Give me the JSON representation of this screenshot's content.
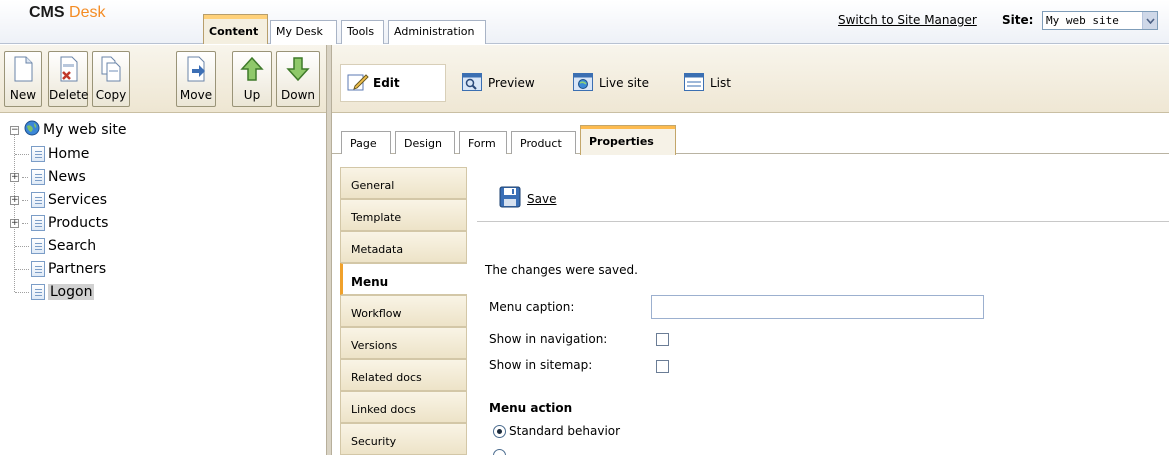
{
  "header": {
    "logo_part1": "CMS",
    "logo_part2": "Desk",
    "tabs": [
      "Content",
      "My Desk",
      "Tools",
      "Administration"
    ],
    "active_tab": "Content",
    "switch_link": "Switch to Site Manager",
    "site_label": "Site:",
    "site_value": "My web site"
  },
  "toolbar": {
    "buttons": [
      "New",
      "Delete",
      "Copy",
      "Move",
      "Up",
      "Down"
    ],
    "view_buttons": {
      "edit": "Edit",
      "preview": "Preview",
      "live_site": "Live site",
      "list": "List"
    }
  },
  "tree": {
    "root": "My web site",
    "items": [
      "Home",
      "News",
      "Services",
      "Products",
      "Search",
      "Partners",
      "Logon"
    ],
    "selected": "Logon",
    "expandable": [
      "News",
      "Services",
      "Products"
    ]
  },
  "content_tabs": [
    "Page",
    "Design",
    "Form",
    "Product",
    "Properties"
  ],
  "active_content_tab": "Properties",
  "side_menu": {
    "items": [
      "General",
      "Template",
      "Metadata",
      "Menu",
      "Workflow",
      "Versions",
      "Related docs",
      "Linked docs",
      "Security"
    ],
    "active": "Menu"
  },
  "form": {
    "save_label": "Save",
    "message": "The changes were saved.",
    "menu_caption_label": "Menu caption:",
    "menu_caption_value": "",
    "show_in_navigation_label": "Show in navigation:",
    "show_in_navigation_checked": false,
    "show_in_sitemap_label": "Show in sitemap:",
    "show_in_sitemap_checked": false,
    "menu_action_title": "Menu action",
    "radio_standard_label": "Standard behavior",
    "radio_standard_selected": true
  },
  "colors": {
    "accent_orange": "#f48c24",
    "tab_highlight": "#fdbb4f",
    "toolbar_bg": "#f3eddd"
  }
}
